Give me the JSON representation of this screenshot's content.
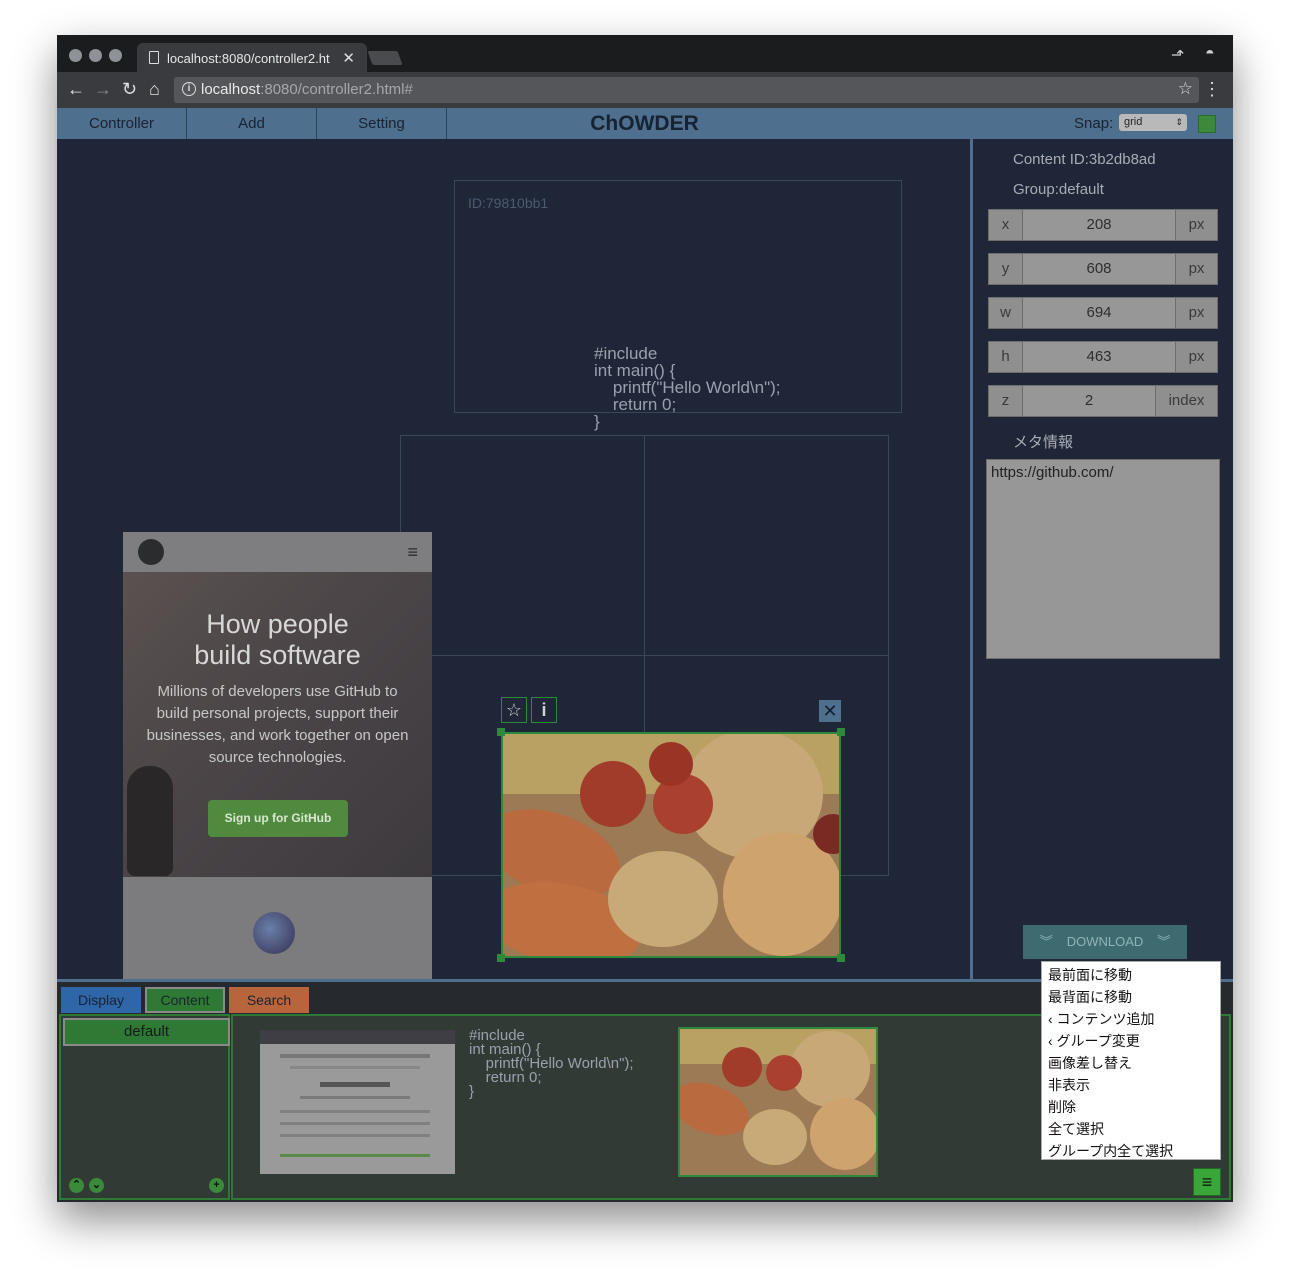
{
  "browser": {
    "tab_title": "localhost:8080/controller2.ht",
    "url_host": "localhost",
    "url_rest": ":8080/controller2.html#"
  },
  "menubar": {
    "items": [
      "Controller",
      "Add",
      "Setting"
    ],
    "title": "ChOWDER",
    "snap_label": "Snap:",
    "snap_value": "grid"
  },
  "workspace": {
    "id_label": "ID:79810bb1",
    "code_text": "#include\nint main() {\n    printf(\"Hello World\\n\");\n    return 0;\n}",
    "github": {
      "heading": "How people\nbuild software",
      "paragraph": "Millions of developers use GitHub to build personal projects, support their businesses, and work together on open source technologies.",
      "button": "Sign up for GitHub"
    }
  },
  "properties": {
    "content_id": "Content ID:3b2db8ad",
    "group": "Group:default",
    "fields": [
      {
        "key": "x",
        "value": "208",
        "unit": "px"
      },
      {
        "key": "y",
        "value": "608",
        "unit": "px"
      },
      {
        "key": "w",
        "value": "694",
        "unit": "px"
      },
      {
        "key": "h",
        "value": "463",
        "unit": "px"
      },
      {
        "key": "z",
        "value": "2",
        "unit": "index"
      }
    ],
    "meta_label": "メタ情報",
    "meta_value": "https://github.com/",
    "download": "DOWNLOAD"
  },
  "bottom": {
    "tabs": [
      "Display",
      "Content",
      "Search"
    ],
    "group_default": "default",
    "code_text": "#include\nint main() {\n    printf(\"Hello World\\n\");\n    return 0;\n}"
  },
  "context_menu": [
    "最前面に移動",
    "最背面に移動",
    "‹  コンテンツ追加",
    "‹  グループ変更",
    "画像差し替え",
    "非表示",
    "削除",
    "全て選択",
    "グループ内全て選択"
  ],
  "colors": {
    "accent": "#4e6f8e",
    "selected_green": "#2e8a3a",
    "display_tab": "#2f66a8",
    "content_tab": "#2e7a34",
    "search_tab": "#b8653e"
  }
}
